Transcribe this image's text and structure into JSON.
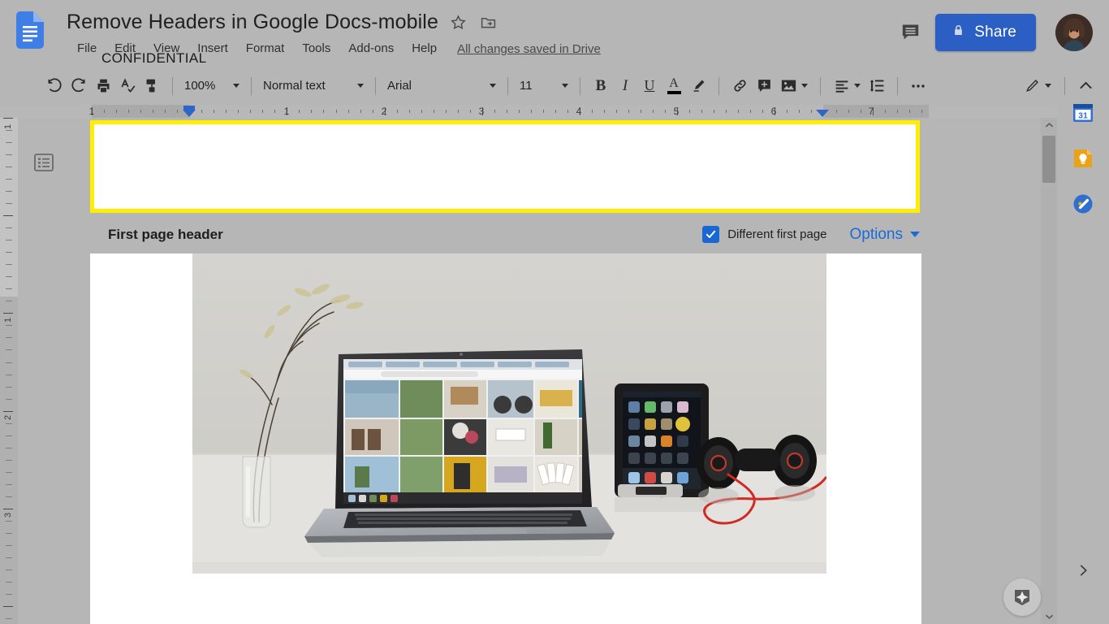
{
  "app": {
    "name": "Google Docs",
    "logo_icon": "google-docs-logo"
  },
  "header": {
    "doc_title": "Remove Headers in Google Docs-mobile",
    "star_icon": "star-icon",
    "move_folder_icon": "move-to-folder-icon",
    "menus": [
      "File",
      "Edit",
      "View",
      "Insert",
      "Format",
      "Tools",
      "Add-ons",
      "Help"
    ],
    "save_state": "All changes saved in Drive",
    "comment_icon": "comment-icon",
    "share_label": "Share",
    "share_lock_icon": "lock-icon",
    "share_color": "#2b5fc4",
    "avatar_icon": "user-avatar"
  },
  "toolbar": {
    "undo_icon": "undo-icon",
    "redo_icon": "redo-icon",
    "print_icon": "print-icon",
    "spellcheck_icon": "spellcheck-icon",
    "paint_format_icon": "paint-format-icon",
    "zoom_value": "100%",
    "style_value": "Normal text",
    "font_value": "Arial",
    "font_size_value": "11",
    "bold_label": "B",
    "italic_label": "I",
    "underline_label": "U",
    "text_color_label": "A",
    "text_color_swatch": "#000000",
    "highlight_icon": "highlight-pen-icon",
    "link_icon": "insert-link-icon",
    "comment_add_icon": "add-comment-icon",
    "image_icon": "insert-image-icon",
    "align_icon": "align-left-icon",
    "line_spacing_icon": "line-spacing-icon",
    "more_icon": "more-options-icon",
    "editing_mode_icon": "pencil-editing-icon",
    "collapse_icon": "collapse-toolbar-icon"
  },
  "ruler": {
    "numbers": [
      "1",
      "1",
      "2",
      "3",
      "4",
      "5",
      "6",
      "7"
    ],
    "left_indent_marker": "left-indent-marker",
    "right_indent_marker": "right-indent-marker"
  },
  "vertical_ruler": {
    "numbers": [
      "1",
      "1",
      "2",
      "3"
    ]
  },
  "outline": {
    "icon": "document-outline-icon"
  },
  "document": {
    "header_content": "CONFIDENTIAL",
    "header_highlight_color": "#ffee00",
    "body_image_alt": "laptop-tablet-headphones-photo"
  },
  "header_toolbar": {
    "label": "First page header",
    "different_first_page_label": "Different first page",
    "different_first_page_checked": true,
    "checkbox_color": "#1967d2",
    "options_label": "Options",
    "options_link_color": "#1a6bd8"
  },
  "right_rail": {
    "items": [
      {
        "icon": "google-calendar-icon",
        "name": "calendar"
      },
      {
        "icon": "google-keep-icon",
        "name": "keep"
      },
      {
        "icon": "google-tasks-icon",
        "name": "tasks"
      }
    ],
    "expand_icon": "chevron-right-icon"
  },
  "explore": {
    "icon": "explore-icon"
  },
  "scrollbar": {
    "up_icon": "scroll-up-icon",
    "down_icon": "scroll-down-icon"
  }
}
